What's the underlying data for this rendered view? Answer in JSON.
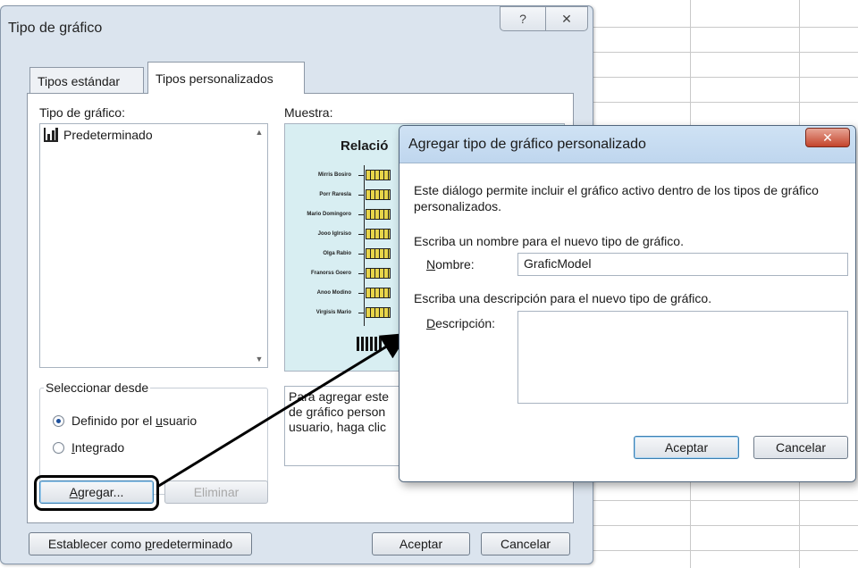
{
  "main_dialog": {
    "title": "Tipo de gráfico",
    "help_glyph": "?",
    "close_glyph": "✕",
    "tabs": [
      {
        "label": "Tipos estándar"
      },
      {
        "label": "Tipos personalizados"
      }
    ],
    "chart_type_label": "Tipo de gráfico:",
    "chart_type_items": [
      "Predeterminado"
    ],
    "sample_label": "Muestra:",
    "sample_preview": {
      "title": "Relació",
      "row_labels": [
        "Mirris Bosiro",
        "Porr Raresla",
        "Mario Domingoro",
        "Jooo Iglrsiso",
        "Olga Rabio",
        "Franorss Goero",
        "Anoo Modino",
        "Virgisis Mario"
      ]
    },
    "select_from_legend": "Seleccionar desde",
    "select_from_options": [
      {
        "prefix": "Definido por el ",
        "ul": "u",
        "suffix": "suario",
        "selected": true
      },
      {
        "prefix": "",
        "ul": "I",
        "suffix": "ntegrado",
        "selected": false
      }
    ],
    "description_lines": [
      "Para agregar este",
      "de gráfico person",
      "usuario, haga clic"
    ],
    "add_button": {
      "ul": "A",
      "rest": "gregar..."
    },
    "delete_button": "Eliminar",
    "set_default_button": {
      "prefix": "Establecer como ",
      "ul": "p",
      "suffix": "redeterminado"
    },
    "ok_button": "Aceptar",
    "cancel_button": "Cancelar"
  },
  "add_dialog": {
    "title": "Agregar tipo de gráfico personalizado",
    "close_glyph": "✕",
    "intro": "Este diálogo permite incluir el gráfico activo dentro de los tipos de gráfico personalizados.",
    "name_prompt": "Escriba un nombre para el nuevo tipo de gráfico.",
    "name_label": {
      "ul": "N",
      "rest": "ombre:"
    },
    "name_value": "GraficModel",
    "desc_prompt": "Escriba una descripción para el nuevo tipo de gráfico.",
    "desc_label": {
      "ul": "D",
      "rest": "escripción:"
    },
    "desc_value": "",
    "ok_button": "Aceptar",
    "cancel_button": "Cancelar"
  }
}
